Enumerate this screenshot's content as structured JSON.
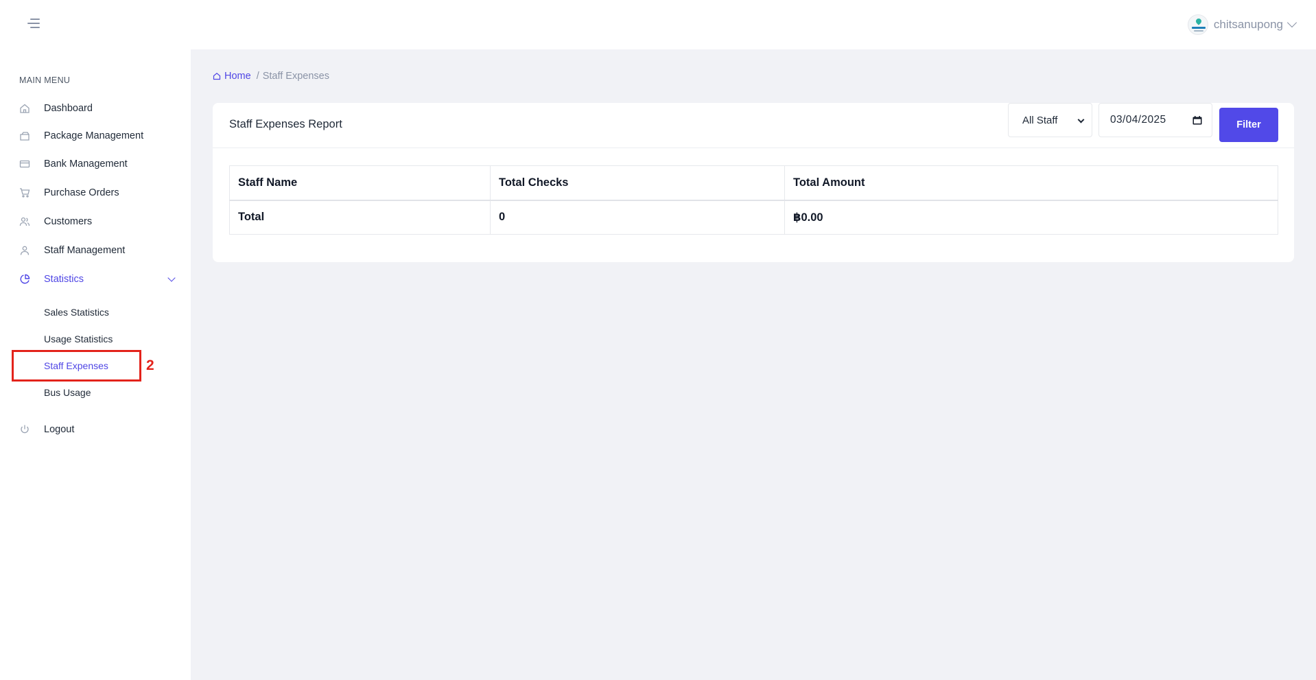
{
  "header": {
    "username": "chitsanupong",
    "menu_icon": "hamburger-icon",
    "avatar_icon": "logo-avatar"
  },
  "sidebar": {
    "section_title": "MAIN MENU",
    "items": [
      {
        "label": "Dashboard",
        "icon": "home-icon"
      },
      {
        "label": "Package Management",
        "icon": "package-icon"
      },
      {
        "label": "Bank Management",
        "icon": "credit-card-icon"
      },
      {
        "label": "Purchase Orders",
        "icon": "cart-icon"
      },
      {
        "label": "Customers",
        "icon": "users-icon"
      },
      {
        "label": "Staff Management",
        "icon": "user-icon"
      },
      {
        "label": "Statistics",
        "icon": "pie-chart-icon",
        "expanded": true
      }
    ],
    "sub_items": [
      {
        "label": "Sales Statistics"
      },
      {
        "label": "Usage Statistics"
      },
      {
        "label": "Staff Expenses",
        "active": true
      },
      {
        "label": "Bus Usage"
      }
    ],
    "logout": {
      "label": "Logout",
      "icon": "power-icon"
    },
    "annotation": {
      "marker": "2"
    }
  },
  "breadcrumb": {
    "home": "Home",
    "separator": "/",
    "current": "Staff Expenses"
  },
  "report": {
    "title": "Staff Expenses Report",
    "staff_filter": {
      "selected": "All Staff"
    },
    "date_filter": {
      "value": "03/04/2025"
    },
    "filter_button": "Filter",
    "table": {
      "columns": [
        "Staff Name",
        "Total Checks",
        "Total Amount"
      ],
      "total_row": [
        "Total",
        "0",
        "฿0.00"
      ]
    }
  },
  "colors": {
    "accent": "#4f46e5",
    "button": "#5149e8",
    "annotation": "#e3231b",
    "background": "#f1f2f6"
  }
}
